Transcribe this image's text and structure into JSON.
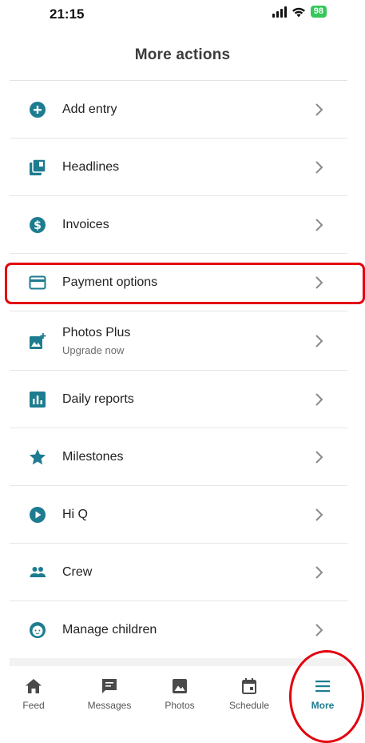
{
  "status": {
    "time": "21:15",
    "battery": "98"
  },
  "header": {
    "title": "More actions"
  },
  "menu": [
    {
      "label": "Add entry",
      "icon": "plus-circle-icon"
    },
    {
      "label": "Headlines",
      "icon": "headlines-icon"
    },
    {
      "label": "Invoices",
      "icon": "dollar-circle-icon"
    },
    {
      "label": "Payment options",
      "icon": "credit-card-icon"
    },
    {
      "label": "Photos Plus",
      "sublabel": "Upgrade now",
      "icon": "photo-plus-icon"
    },
    {
      "label": "Daily reports",
      "icon": "bar-chart-icon"
    },
    {
      "label": "Milestones",
      "icon": "star-icon"
    },
    {
      "label": "Hi Q",
      "icon": "play-circle-icon"
    },
    {
      "label": "Crew",
      "icon": "people-icon"
    },
    {
      "label": "Manage children",
      "icon": "child-face-icon"
    }
  ],
  "tabs": [
    {
      "label": "Feed",
      "icon": "home-icon"
    },
    {
      "label": "Messages",
      "icon": "message-icon"
    },
    {
      "label": "Photos",
      "icon": "photo-icon"
    },
    {
      "label": "Schedule",
      "icon": "calendar-icon"
    },
    {
      "label": "More",
      "icon": "menu-icon",
      "active": true
    }
  ],
  "colors": {
    "accent": "#1d7c8f",
    "highlight": "#e3000f"
  }
}
